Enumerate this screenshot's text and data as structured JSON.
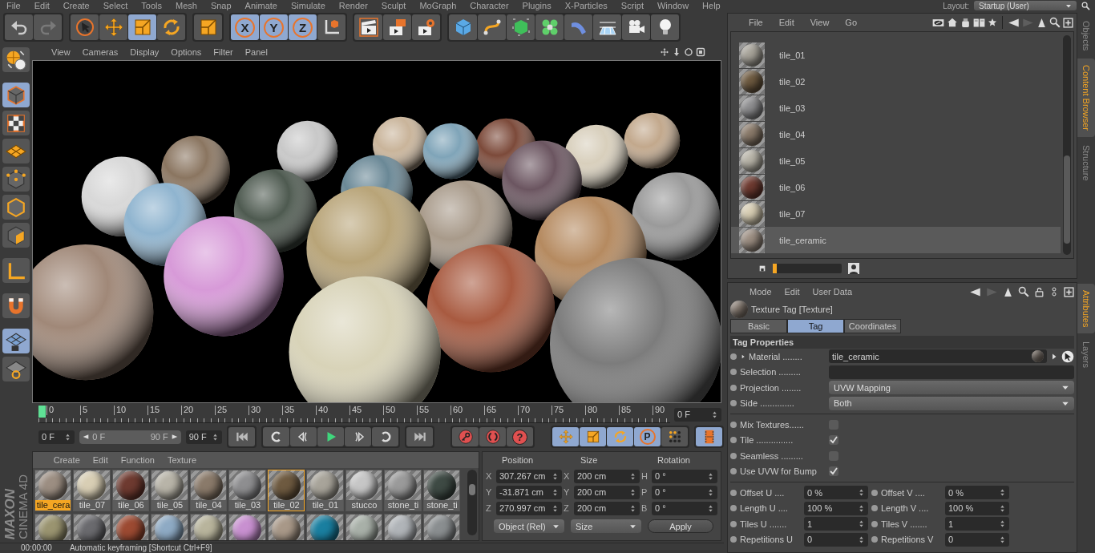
{
  "menu_bar": [
    "File",
    "Edit",
    "Create",
    "Select",
    "Tools",
    "Mesh",
    "Snap",
    "Animate",
    "Simulate",
    "Render",
    "Sculpt",
    "MoGraph",
    "Character",
    "Plugins",
    "X-Particles",
    "Script",
    "Window",
    "Help"
  ],
  "layout": {
    "label": "Layout:",
    "value": "Startup (User)"
  },
  "toolbar": [
    [
      {
        "selected": false,
        "disabled": false
      },
      {
        "selected": false,
        "disabled": true
      }
    ],
    [
      {
        "selected": false,
        "disabled": false
      },
      {
        "selected": false,
        "disabled": false
      },
      {
        "selected": true,
        "disabled": false
      },
      {
        "selected": false,
        "disabled": false
      }
    ],
    [
      {
        "selected": false,
        "disabled": false
      }
    ],
    [
      {
        "label": "X",
        "selected": true,
        "disabled": false
      },
      {
        "label": "Y",
        "selected": true,
        "disabled": false
      },
      {
        "label": "Z",
        "selected": true,
        "disabled": false
      },
      {
        "selected": false,
        "disabled": false
      }
    ],
    [
      {
        "selected": false,
        "disabled": false
      },
      {
        "selected": false,
        "disabled": false
      },
      {
        "selected": false,
        "disabled": false
      }
    ],
    [
      {
        "selected": false,
        "disabled": false
      },
      {
        "selected": false,
        "disabled": false
      },
      {
        "selected": false,
        "disabled": false
      },
      {
        "selected": false,
        "disabled": false
      },
      {
        "selected": false,
        "disabled": false
      },
      {
        "selected": false,
        "disabled": false
      },
      {
        "selected": false,
        "disabled": false
      },
      {
        "selected": false,
        "disabled": false
      }
    ]
  ],
  "tool_palette": [
    {
      "selected": false
    },
    {
      "selected": true
    },
    {
      "selected": false
    },
    {
      "selected": false
    },
    {
      "selected": false
    },
    {
      "selected": false
    },
    {
      "selected": false
    },
    {
      "selected": false
    },
    {
      "selected": false
    },
    {
      "selected": true
    },
    {
      "selected": false
    }
  ],
  "viewport": {
    "menu": [
      "View",
      "Cameras",
      "Display",
      "Options",
      "Filter",
      "Panel"
    ]
  },
  "timeline": {
    "ticks": [
      "0",
      "5",
      "10",
      "15",
      "20",
      "25",
      "30",
      "35",
      "40",
      "45",
      "50",
      "55",
      "60",
      "65",
      "70",
      "75",
      "80",
      "85",
      "90"
    ],
    "playhead": {
      "level": 0
    },
    "current_frame": "0 F"
  },
  "transport": {
    "start": "0 F",
    "range": {
      "start": "0 F",
      "end": "90 F",
      "level": 1
    },
    "end": "90 F",
    "groups": [
      [
        {
          "selected": false
        }
      ],
      [
        {
          "selected": false
        },
        {
          "selected": false
        },
        {
          "selected": false
        },
        {
          "selected": false
        },
        {
          "selected": false
        }
      ],
      [
        {
          "selected": false
        }
      ],
      [
        {
          "selected": false
        },
        {
          "selected": false
        },
        {
          "label": "?",
          "selected": false
        }
      ],
      [
        {
          "selected": true
        },
        {
          "selected": true
        },
        {
          "selected": true
        },
        {
          "label": "P",
          "selected": true
        },
        {
          "selected": false
        }
      ],
      [
        {
          "selected": true
        }
      ]
    ]
  },
  "logo": {
    "brand": "MAXON",
    "product": "CINEMA 4D"
  },
  "materials": {
    "menu": [
      "Create",
      "Edit",
      "Function",
      "Texture"
    ],
    "row_1": [
      {
        "label": "tile_cera",
        "color": "#9c8e82",
        "selected": true,
        "highlighted": false
      },
      {
        "label": "tile_07",
        "color": "#d8ceb4",
        "selected": false,
        "highlighted": false
      },
      {
        "label": "tile_06",
        "color": "#6e3a30",
        "selected": false,
        "highlighted": false
      },
      {
        "label": "tile_05",
        "color": "#b8b4a8",
        "selected": false,
        "highlighted": false
      },
      {
        "label": "tile_04",
        "color": "#8a7a6a",
        "selected": false,
        "highlighted": false
      },
      {
        "label": "tile_03",
        "color": "#8e8e90",
        "selected": false,
        "highlighted": false
      },
      {
        "label": "tile_02",
        "color": "#6e5a40",
        "selected": false,
        "highlighted": true
      },
      {
        "label": "tile_01",
        "color": "#a8a49a",
        "selected": false,
        "highlighted": false
      },
      {
        "label": "stucco",
        "color": "#c6c6c6",
        "selected": false,
        "highlighted": false
      },
      {
        "label": "stone_ti",
        "color": "#9a9a9a",
        "selected": false,
        "highlighted": false
      },
      {
        "label": "stone_ti",
        "color": "#3e4a44",
        "selected": false,
        "highlighted": false
      }
    ],
    "row_2": [
      {
        "color": "#9a9470",
        "selected": false
      },
      {
        "color": "#6a6a6e",
        "selected": false
      },
      {
        "color": "#9c4a32",
        "selected": false
      },
      {
        "color": "#8eaac4",
        "selected": false
      },
      {
        "color": "#b8b49c",
        "selected": false
      },
      {
        "color": "#c890d0",
        "selected": false
      },
      {
        "color": "#a89888",
        "selected": false
      },
      {
        "color": "#1a7fa0",
        "selected": false
      },
      {
        "color": "#a8b0a8",
        "selected": false
      },
      {
        "color": "#b0b4b8",
        "selected": false
      },
      {
        "color": "#8a8e90",
        "selected": false
      }
    ]
  },
  "coordinates": {
    "headers": [
      "Position",
      "Size",
      "Rotation"
    ],
    "rows": [
      [
        {
          "axis": "X",
          "value": "307.267 cm"
        },
        {
          "axis": "X",
          "value": "200 cm"
        },
        {
          "axis": "H",
          "value": "0 °"
        }
      ],
      [
        {
          "axis": "Y",
          "value": "-31.871 cm"
        },
        {
          "axis": "Y",
          "value": "200 cm"
        },
        {
          "axis": "P",
          "value": "0 °"
        }
      ],
      [
        {
          "axis": "Z",
          "value": "270.997 cm"
        },
        {
          "axis": "Z",
          "value": "200 cm"
        },
        {
          "axis": "B",
          "value": "0 °"
        }
      ]
    ],
    "mode_dropdown": "Object (Rel)",
    "size_dropdown": "Size",
    "apply": "Apply"
  },
  "status_bar": {
    "time": "00:00:00",
    "message": "Automatic keyframing [Shortcut Ctrl+F9]"
  },
  "content_browser": {
    "menu": [
      "File",
      "Edit",
      "View",
      "Go"
    ],
    "items": [
      {
        "label": "tile_01",
        "color": "#a8a49a",
        "selected": false
      },
      {
        "label": "tile_02",
        "color": "#6e5a40",
        "selected": false
      },
      {
        "label": "tile_03",
        "color": "#8e8e90",
        "selected": false
      },
      {
        "label": "tile_04",
        "color": "#8a7a6a",
        "selected": false
      },
      {
        "label": "tile_05",
        "color": "#b8b4a8",
        "selected": false
      },
      {
        "label": "tile_06",
        "color": "#6e3a30",
        "selected": false
      },
      {
        "label": "tile_07",
        "color": "#d8ceb4",
        "selected": false
      },
      {
        "label": "tile_ceramic",
        "color": "#9c8e82",
        "selected": true
      }
    ],
    "preview_size": {
      "level": 0.06
    },
    "side_tabs": [
      {
        "label": "Objects",
        "selected": false
      },
      {
        "label": "Content Browser",
        "selected": true
      },
      {
        "label": "Structure",
        "selected": false
      }
    ]
  },
  "attributes": {
    "menu": [
      "Mode",
      "Edit",
      "User Data"
    ],
    "title": "Texture Tag [Texture]",
    "tabs": [
      {
        "label": "Basic",
        "selected": false
      },
      {
        "label": "Tag",
        "selected": true
      },
      {
        "label": "Coordinates",
        "selected": false
      }
    ],
    "section": "Tag Properties",
    "rows": [
      {
        "kind": "link",
        "label": "Material ........",
        "value": "tile_ceramic"
      },
      {
        "kind": "field",
        "label": "Selection ........."
      },
      {
        "kind": "dropdown",
        "label": "Projection ........",
        "value": "UVW Mapping"
      },
      {
        "kind": "dropdown",
        "label": "Side ..............",
        "value": "Both"
      },
      {
        "kind": "checkbox",
        "label": "Mix Textures......",
        "checked": false
      },
      {
        "kind": "checkbox",
        "label": "Tile ...............",
        "checked": true
      },
      {
        "kind": "checkbox",
        "label": "Seamless .........",
        "checked": false
      },
      {
        "kind": "checkbox",
        "label": "Use UVW for Bump",
        "checked": true
      },
      {
        "kind": "pair",
        "items": [
          {
            "label": "Offset U ....",
            "value": "0 %"
          },
          {
            "label": "Offset V ....",
            "value": "0 %"
          }
        ]
      },
      {
        "kind": "pair",
        "items": [
          {
            "label": "Length U ....",
            "value": "100 %"
          },
          {
            "label": "Length V ....",
            "value": "100 %"
          }
        ]
      },
      {
        "kind": "pair",
        "items": [
          {
            "label": "Tiles U .......",
            "value": "1"
          },
          {
            "label": "Tiles V .......",
            "value": "1"
          }
        ]
      },
      {
        "kind": "pair",
        "items": [
          {
            "label": "Repetitions U",
            "value": "0"
          },
          {
            "label": "Repetitions V",
            "value": "0"
          }
        ]
      }
    ],
    "side_tabs": [
      {
        "label": "Attributes",
        "selected": true
      },
      {
        "label": "Layers",
        "selected": false
      }
    ]
  }
}
